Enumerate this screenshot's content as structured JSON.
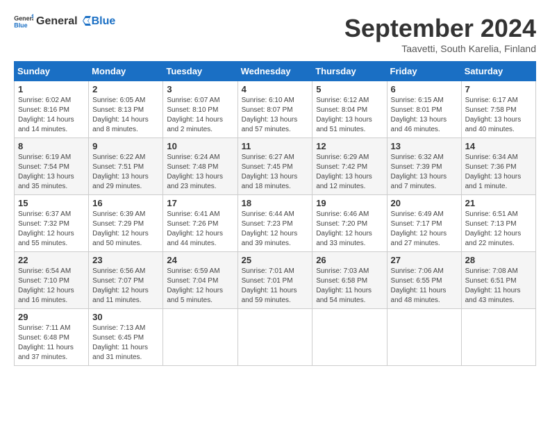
{
  "header": {
    "logo_general": "General",
    "logo_blue": "Blue",
    "month_title": "September 2024",
    "location": "Taavetti, South Karelia, Finland"
  },
  "weekdays": [
    "Sunday",
    "Monday",
    "Tuesday",
    "Wednesday",
    "Thursday",
    "Friday",
    "Saturday"
  ],
  "weeks": [
    [
      {
        "day": "1",
        "sunrise": "Sunrise: 6:02 AM",
        "sunset": "Sunset: 8:16 PM",
        "daylight": "Daylight: 14 hours and 14 minutes."
      },
      {
        "day": "2",
        "sunrise": "Sunrise: 6:05 AM",
        "sunset": "Sunset: 8:13 PM",
        "daylight": "Daylight: 14 hours and 8 minutes."
      },
      {
        "day": "3",
        "sunrise": "Sunrise: 6:07 AM",
        "sunset": "Sunset: 8:10 PM",
        "daylight": "Daylight: 14 hours and 2 minutes."
      },
      {
        "day": "4",
        "sunrise": "Sunrise: 6:10 AM",
        "sunset": "Sunset: 8:07 PM",
        "daylight": "Daylight: 13 hours and 57 minutes."
      },
      {
        "day": "5",
        "sunrise": "Sunrise: 6:12 AM",
        "sunset": "Sunset: 8:04 PM",
        "daylight": "Daylight: 13 hours and 51 minutes."
      },
      {
        "day": "6",
        "sunrise": "Sunrise: 6:15 AM",
        "sunset": "Sunset: 8:01 PM",
        "daylight": "Daylight: 13 hours and 46 minutes."
      },
      {
        "day": "7",
        "sunrise": "Sunrise: 6:17 AM",
        "sunset": "Sunset: 7:58 PM",
        "daylight": "Daylight: 13 hours and 40 minutes."
      }
    ],
    [
      {
        "day": "8",
        "sunrise": "Sunrise: 6:19 AM",
        "sunset": "Sunset: 7:54 PM",
        "daylight": "Daylight: 13 hours and 35 minutes."
      },
      {
        "day": "9",
        "sunrise": "Sunrise: 6:22 AM",
        "sunset": "Sunset: 7:51 PM",
        "daylight": "Daylight: 13 hours and 29 minutes."
      },
      {
        "day": "10",
        "sunrise": "Sunrise: 6:24 AM",
        "sunset": "Sunset: 7:48 PM",
        "daylight": "Daylight: 13 hours and 23 minutes."
      },
      {
        "day": "11",
        "sunrise": "Sunrise: 6:27 AM",
        "sunset": "Sunset: 7:45 PM",
        "daylight": "Daylight: 13 hours and 18 minutes."
      },
      {
        "day": "12",
        "sunrise": "Sunrise: 6:29 AM",
        "sunset": "Sunset: 7:42 PM",
        "daylight": "Daylight: 13 hours and 12 minutes."
      },
      {
        "day": "13",
        "sunrise": "Sunrise: 6:32 AM",
        "sunset": "Sunset: 7:39 PM",
        "daylight": "Daylight: 13 hours and 7 minutes."
      },
      {
        "day": "14",
        "sunrise": "Sunrise: 6:34 AM",
        "sunset": "Sunset: 7:36 PM",
        "daylight": "Daylight: 13 hours and 1 minute."
      }
    ],
    [
      {
        "day": "15",
        "sunrise": "Sunrise: 6:37 AM",
        "sunset": "Sunset: 7:32 PM",
        "daylight": "Daylight: 12 hours and 55 minutes."
      },
      {
        "day": "16",
        "sunrise": "Sunrise: 6:39 AM",
        "sunset": "Sunset: 7:29 PM",
        "daylight": "Daylight: 12 hours and 50 minutes."
      },
      {
        "day": "17",
        "sunrise": "Sunrise: 6:41 AM",
        "sunset": "Sunset: 7:26 PM",
        "daylight": "Daylight: 12 hours and 44 minutes."
      },
      {
        "day": "18",
        "sunrise": "Sunrise: 6:44 AM",
        "sunset": "Sunset: 7:23 PM",
        "daylight": "Daylight: 12 hours and 39 minutes."
      },
      {
        "day": "19",
        "sunrise": "Sunrise: 6:46 AM",
        "sunset": "Sunset: 7:20 PM",
        "daylight": "Daylight: 12 hours and 33 minutes."
      },
      {
        "day": "20",
        "sunrise": "Sunrise: 6:49 AM",
        "sunset": "Sunset: 7:17 PM",
        "daylight": "Daylight: 12 hours and 27 minutes."
      },
      {
        "day": "21",
        "sunrise": "Sunrise: 6:51 AM",
        "sunset": "Sunset: 7:13 PM",
        "daylight": "Daylight: 12 hours and 22 minutes."
      }
    ],
    [
      {
        "day": "22",
        "sunrise": "Sunrise: 6:54 AM",
        "sunset": "Sunset: 7:10 PM",
        "daylight": "Daylight: 12 hours and 16 minutes."
      },
      {
        "day": "23",
        "sunrise": "Sunrise: 6:56 AM",
        "sunset": "Sunset: 7:07 PM",
        "daylight": "Daylight: 12 hours and 11 minutes."
      },
      {
        "day": "24",
        "sunrise": "Sunrise: 6:59 AM",
        "sunset": "Sunset: 7:04 PM",
        "daylight": "Daylight: 12 hours and 5 minutes."
      },
      {
        "day": "25",
        "sunrise": "Sunrise: 7:01 AM",
        "sunset": "Sunset: 7:01 PM",
        "daylight": "Daylight: 11 hours and 59 minutes."
      },
      {
        "day": "26",
        "sunrise": "Sunrise: 7:03 AM",
        "sunset": "Sunset: 6:58 PM",
        "daylight": "Daylight: 11 hours and 54 minutes."
      },
      {
        "day": "27",
        "sunrise": "Sunrise: 7:06 AM",
        "sunset": "Sunset: 6:55 PM",
        "daylight": "Daylight: 11 hours and 48 minutes."
      },
      {
        "day": "28",
        "sunrise": "Sunrise: 7:08 AM",
        "sunset": "Sunset: 6:51 PM",
        "daylight": "Daylight: 11 hours and 43 minutes."
      }
    ],
    [
      {
        "day": "29",
        "sunrise": "Sunrise: 7:11 AM",
        "sunset": "Sunset: 6:48 PM",
        "daylight": "Daylight: 11 hours and 37 minutes."
      },
      {
        "day": "30",
        "sunrise": "Sunrise: 7:13 AM",
        "sunset": "Sunset: 6:45 PM",
        "daylight": "Daylight: 11 hours and 31 minutes."
      },
      null,
      null,
      null,
      null,
      null
    ]
  ]
}
